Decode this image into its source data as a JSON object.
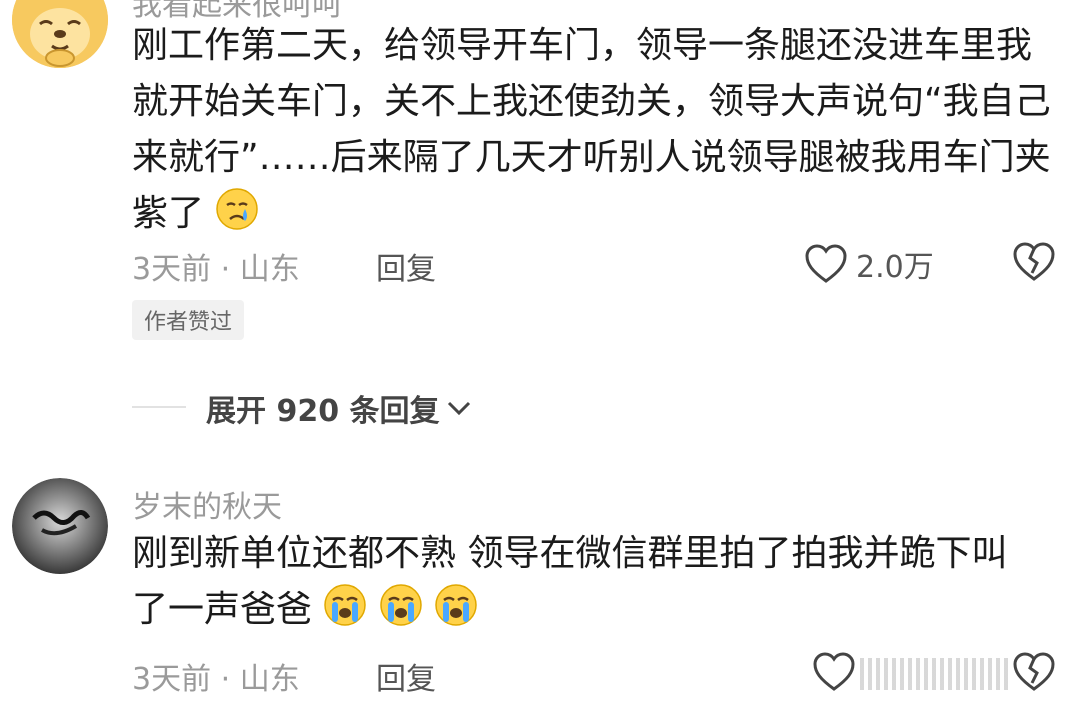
{
  "comments": [
    {
      "username": "我看起来很呵呵",
      "text": "刚工作第二天，给领导开车门，领导一条腿还没进车里我就开始关车门，关不上我还使劲关，领导大声说句“我自己来就行”……后来隔了几天才听别人说领导腿被我用车门夹紫了",
      "emoji": "crying-face",
      "time": "3天前",
      "location": "山东",
      "reply_label": "回复",
      "likes": "2.0万",
      "badge": "作者赞过"
    },
    {
      "username": "岁末的秋天",
      "text": "刚到新单位还都不熟  领导在微信群里拍了拍我并跪下叫了一声爸爸",
      "emoji": "loudly-crying-face",
      "time": "3天前",
      "location": "山东",
      "reply_label": "回复"
    }
  ],
  "expand_replies": "展开 920 条回复",
  "meta_separator": " · ",
  "colors": {
    "meta": "#9a9a9a",
    "text": "#1b1b1b",
    "badge_bg": "#f1f1f1"
  }
}
